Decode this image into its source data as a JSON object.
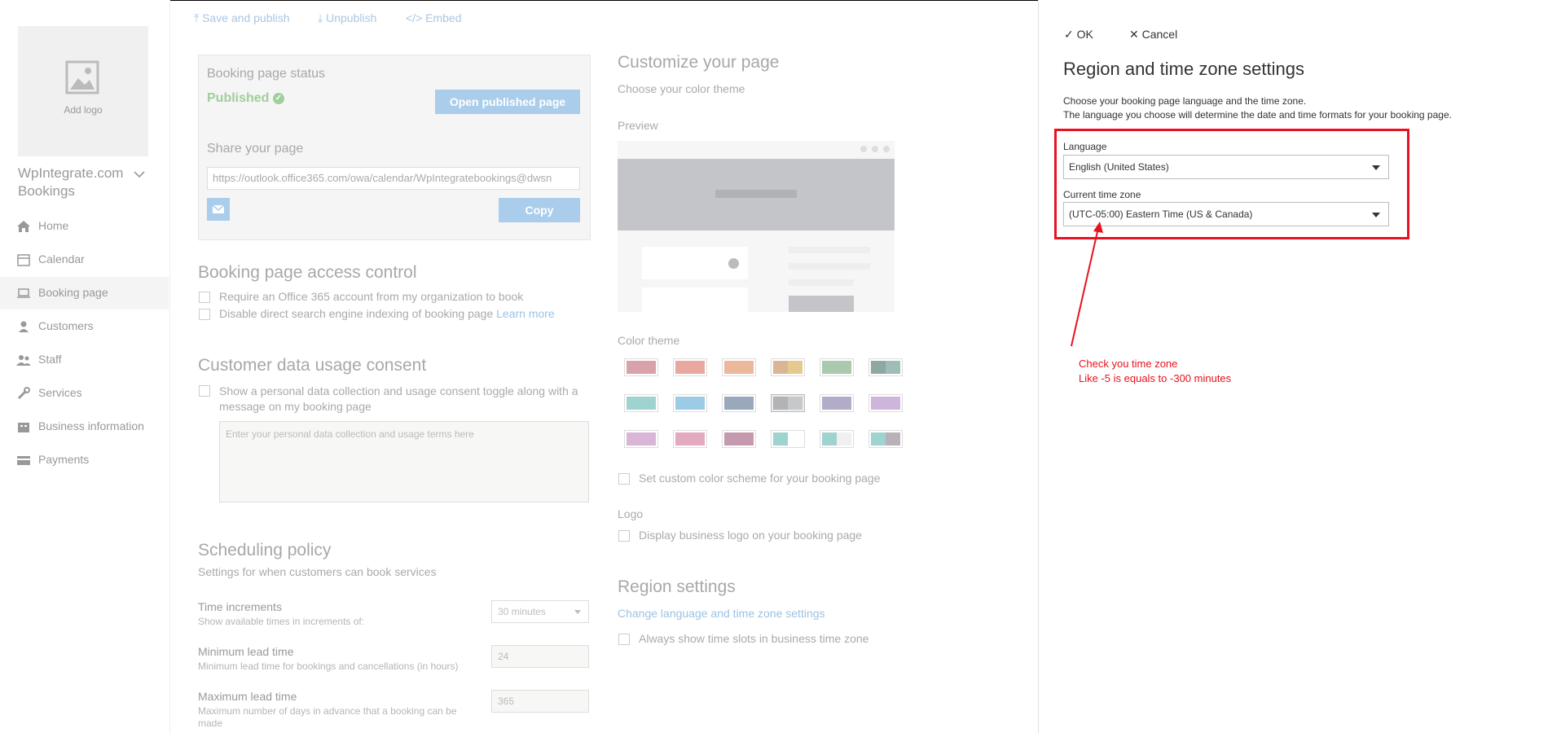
{
  "toolbar": {
    "save_publish": "Save and publish",
    "unpublish": "Unpublish",
    "embed": "Embed"
  },
  "nav": {
    "add_logo": "Add logo",
    "business_name_line1": "WpIntegrate.com",
    "business_name_line2": "Bookings",
    "items": [
      {
        "label": "Home",
        "icon": "home-icon"
      },
      {
        "label": "Calendar",
        "icon": "calendar-icon"
      },
      {
        "label": "Booking page",
        "icon": "laptop-icon"
      },
      {
        "label": "Customers",
        "icon": "person-icon"
      },
      {
        "label": "Staff",
        "icon": "people-icon"
      },
      {
        "label": "Services",
        "icon": "wrench-icon"
      },
      {
        "label": "Business information",
        "icon": "building-icon"
      },
      {
        "label": "Payments",
        "icon": "card-icon"
      }
    ]
  },
  "status_card": {
    "title": "Booking page status",
    "status": "Published",
    "open_button": "Open published page",
    "share_title": "Share your page",
    "url": "https://outlook.office365.com/owa/calendar/WpIntegratebookings@dwsn",
    "copy_button": "Copy"
  },
  "access": {
    "title": "Booking page access control",
    "opt1": "Require an Office 365 account from my organization to book",
    "opt2": "Disable direct search engine indexing of booking page",
    "learn_more": "Learn more"
  },
  "consent": {
    "title": "Customer data usage consent",
    "opt_line1": "Show a personal data collection and usage consent toggle along with a",
    "opt_line2": "message on my booking page",
    "placeholder": "Enter your personal data collection and usage terms here"
  },
  "scheduling": {
    "title": "Scheduling policy",
    "subtitle": "Settings for when customers can book services",
    "time_inc_label": "Time increments",
    "time_inc_desc": "Show available times in increments of:",
    "time_inc_value": "30 minutes",
    "min_lead_label": "Minimum lead time",
    "min_lead_desc": "Minimum lead time for bookings and cancellations (in hours)",
    "min_lead_value": "24",
    "max_lead_label": "Maximum lead time",
    "max_lead_desc_1": "Maximum number of days in advance that a booking can be",
    "max_lead_desc_2": "made",
    "max_lead_value": "365"
  },
  "customize": {
    "title": "Customize your page",
    "subtitle": "Choose your color theme",
    "preview": "Preview",
    "color_theme": "Color theme",
    "custom_scheme": "Set custom color scheme for your booking page",
    "logo_title": "Logo",
    "logo_opt": "Display business logo on your booking page",
    "region_title": "Region settings",
    "region_link": "Change language and time zone settings",
    "region_opt": "Always show time slots in business time zone",
    "swatches": [
      [
        "#d9a2aa",
        "#d9a2aa"
      ],
      [
        "#e8a79f",
        "#e8a79f"
      ],
      [
        "#ebb89c",
        "#ebb89c"
      ],
      [
        "#d9b796",
        "#e6c98e"
      ],
      [
        "#aac9ad",
        "#aac9ad"
      ],
      [
        "#8fa8a4",
        "#9ebdb7"
      ],
      [
        "#9fd3cf",
        "#9fd3cf"
      ],
      [
        "#9ccbe6",
        "#9ccbe6"
      ],
      [
        "#9aa8bb",
        "#9aa8bb"
      ],
      [
        "#b1b3b6",
        "#c7c8ca"
      ],
      [
        "#b3acc9",
        "#b3acc9"
      ],
      [
        "#ceb5dc",
        "#ceb5dc"
      ],
      [
        "#d9b5d8",
        "#d9b5d8"
      ],
      [
        "#e3a9c1",
        "#e3a9c1"
      ],
      [
        "#c59aae",
        "#c59aae"
      ],
      [
        "#9fd3cf",
        "#ffffff"
      ],
      [
        "#9fd3cf",
        "#f0f0f0"
      ],
      [
        "#9fd3cf",
        "#b9b1b8"
      ]
    ]
  },
  "panel": {
    "ok": "OK",
    "cancel": "Cancel",
    "title": "Region and time zone settings",
    "desc1": "Choose your booking page language and the time zone.",
    "desc2": "The language you choose will determine the date and time formats for your booking page.",
    "language_label": "Language",
    "language_value": "English (United States)",
    "timezone_label": "Current time zone",
    "timezone_value": "(UTC-05:00) Eastern Time (US & Canada)"
  },
  "annotation": {
    "line1": "Check you time zone",
    "line2": "Like -5 is equals to -300 minutes",
    "color": "#e8121e"
  }
}
